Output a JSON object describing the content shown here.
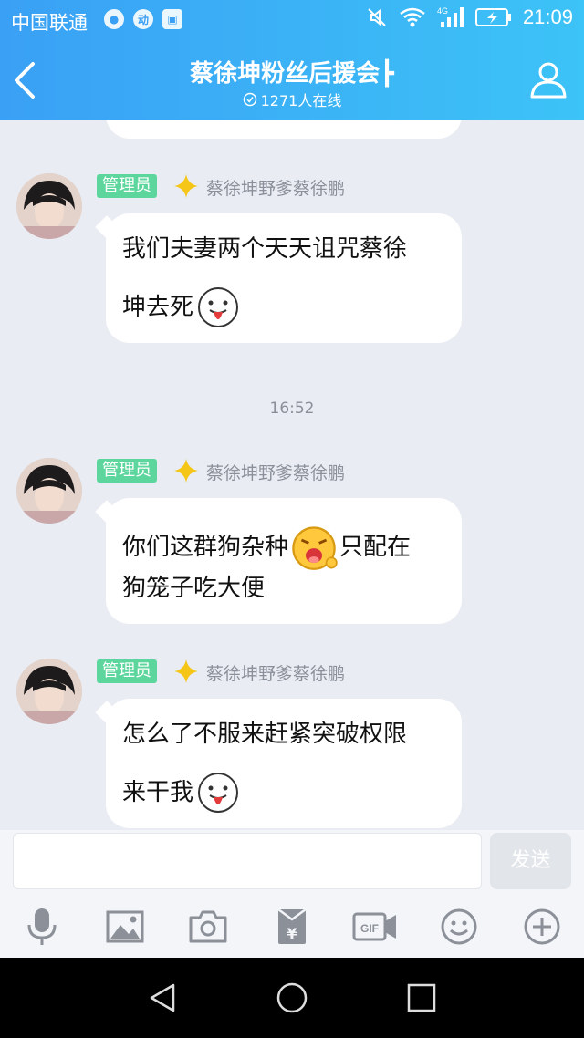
{
  "status_bar": {
    "carrier": "中国联通",
    "network": "4G",
    "time": "21:09"
  },
  "header": {
    "title": "蔡徐坤粉丝后援会",
    "online_count": "1271人在线"
  },
  "messages": [
    {
      "role": "管理员",
      "sender": "蔡徐坤野爹蔡徐鹏",
      "line1": "我们夫妻两个天天诅咒蔡徐",
      "line2": "坤去死",
      "emoji": "tongue-emoji"
    },
    {
      "timestamp": "16:52"
    },
    {
      "role": "管理员",
      "sender": "蔡徐坤野爹蔡徐鹏",
      "line1a": "你们这群狗杂种",
      "line1b": "只配在",
      "line2": "狗笼子吃大便",
      "emoji": "crying-emoji"
    },
    {
      "role": "管理员",
      "sender": "蔡徐坤野爹蔡徐鹏",
      "line1": "怎么了不服来赶紧突破权限",
      "line2": "来干我",
      "emoji": "tongue-emoji"
    }
  ],
  "input": {
    "placeholder": "",
    "send_label": "发送"
  },
  "toolbar": {
    "icons": [
      "microphone-icon",
      "image-icon",
      "camera-icon",
      "red-packet-icon",
      "gif-icon",
      "emoji-icon",
      "plus-icon"
    ],
    "gif_label": "GIF"
  },
  "colors": {
    "header_start": "#3aa0f5",
    "header_end": "#3cc3f7",
    "admin_badge": "#5cd69c",
    "chat_background": "#e9ecf2"
  }
}
